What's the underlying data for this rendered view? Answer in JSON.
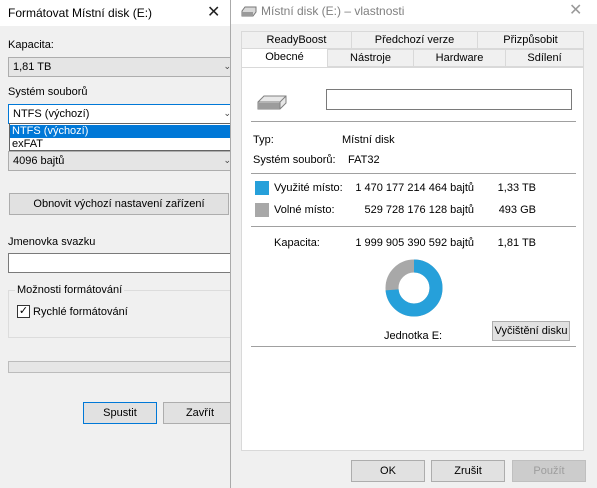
{
  "format_dialog": {
    "title": "Formátovat Místní disk (E:)",
    "capacity_label": "Kapacita:",
    "capacity_value": "1,81 TB",
    "filesystem_label": "Systém souborů",
    "filesystem_value": "NTFS (výchozí)",
    "filesystem_options": [
      "NTFS (výchozí)",
      "exFAT"
    ],
    "allocation_value": "4096 bajtů",
    "restore_button": "Obnovit výchozí nastavení zařízení",
    "volume_label": "Jmenovka svazku",
    "volume_value": "",
    "options_group": "Možnosti formátování",
    "quick_format_label": "Rychlé formátování",
    "quick_format_checked": true,
    "start_button": "Spustit",
    "close_button": "Zavřít"
  },
  "properties_dialog": {
    "title": "Místní disk (E:) – vlastnosti",
    "tabs_row1": [
      "ReadyBoost",
      "Předchozí verze",
      "Přizpůsobit"
    ],
    "tabs_row2": [
      "Obecné",
      "Nástroje",
      "Hardware",
      "Sdílení"
    ],
    "active_tab": "Obecné",
    "name_value": "",
    "type_label": "Typ:",
    "type_value": "Místní disk",
    "fs_label": "Systém souborů:",
    "fs_value": "FAT32",
    "used_label": "Využité místo:",
    "used_bytes": "1 470 177 214 464 bajtů",
    "used_size": "1,33 TB",
    "free_label": "Volné místo:",
    "free_bytes": "529 728 176 128 bajtů",
    "free_size": "493 GB",
    "capacity_label": "Kapacita:",
    "capacity_bytes": "1 999 905 390 592 bajtů",
    "capacity_size": "1,81 TB",
    "drive_label": "Jednotka E:",
    "cleanup_button": "Vyčištění disku",
    "ok_button": "OK",
    "cancel_button": "Zrušit",
    "apply_button": "Použít",
    "used_fraction": 0.735,
    "colors": {
      "used": "#26a0da",
      "free": "#a8a8a8"
    }
  }
}
